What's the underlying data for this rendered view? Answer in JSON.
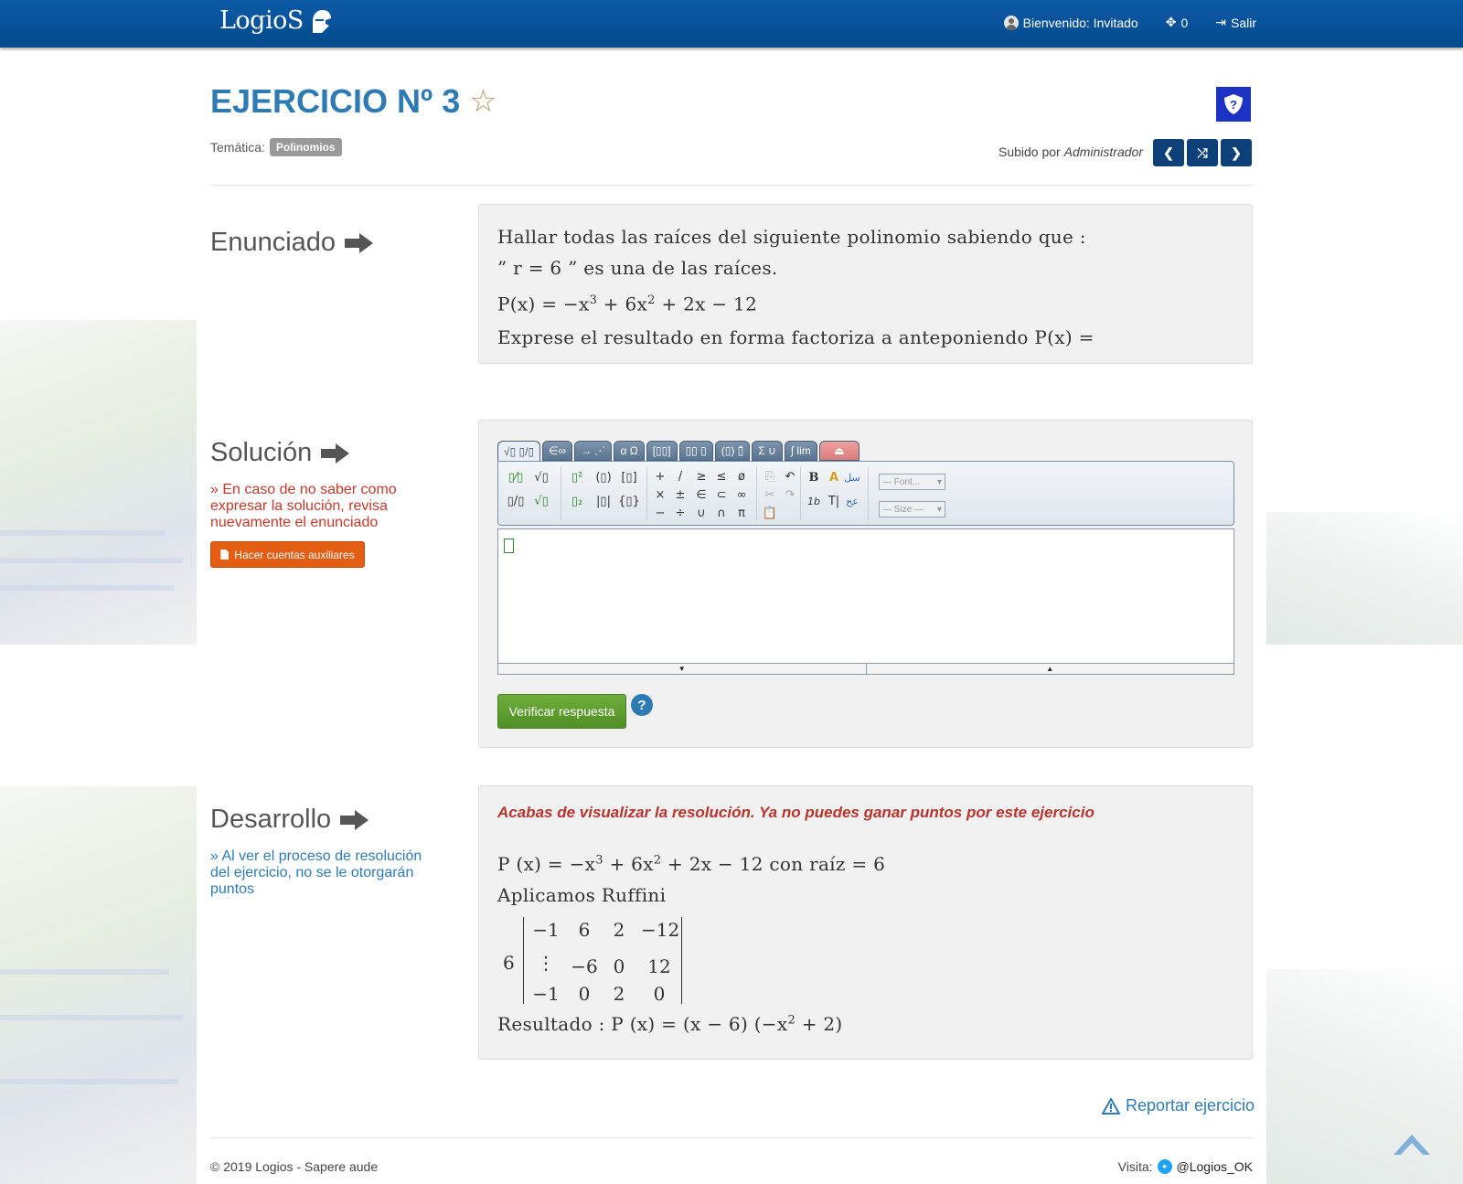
{
  "header": {
    "logo_text": "LogioS",
    "welcome": "Bienvenido: Invitado",
    "points": "0",
    "logout": "Salir"
  },
  "exercise": {
    "title": "EJERCICIO Nº 3",
    "tematica_label": "Temática:",
    "tematica_tag": "Polinomios",
    "uploaded_by_label": "Subido por",
    "uploaded_by": "Administrador"
  },
  "sections": {
    "enunciado": "Enunciado",
    "solucion": "Solución",
    "desarrollo": "Desarrollo"
  },
  "enunciado": {
    "line1": "Hallar  todas  las  raíces  del  siguiente  polinomio  sabiendo  que :",
    "line2": "” r = 6 ”  es  una  de  las  raíces.",
    "line3_pre": "P(x) = −x",
    "line3_e1": "3",
    "line3_mid": " + 6x",
    "line3_e2": "2",
    "line3_post": " + 2x − 12",
    "line4": " Exprese  el  resultado  en  forma  factoriza  a  anteponiendo  P(x) ="
  },
  "solucion": {
    "note": "» En caso de no saber como expresar la solución, revisa nuevamente el enunciado",
    "aux_button": "Hacer cuentas auxiliares",
    "verify_button": "Verificar respuesta",
    "help": "?",
    "font_select": "— Font...",
    "size_select": "— Size —"
  },
  "editor_tabs": [
    "√▯ ▯/▯",
    "∈∞",
    "→ ⋰",
    "α Ω",
    "[▯▯]",
    "▯▯ ▯",
    "(▯) ▯̂",
    "Σ ∪",
    "∫ lim",
    ""
  ],
  "desarrollo": {
    "note": "» Al ver el proceso de resolución del ejercicio, no se le otorgarán puntos",
    "warning": "Acabas de visualizar la resolución. Ya no puedes ganar puntos por este ejercicio",
    "line1_pre": "P (x) = −x",
    "line1_e1": "3",
    "line1_mid": " + 6x",
    "line1_e2": "2",
    "line1_post": " + 2x − 12  con  raíz = 6",
    "line2": " Aplicamos  Ruffini",
    "ruffini_root": "6",
    "ruffini_rows": [
      [
        "−1",
        "6",
        "2",
        "−12"
      ],
      [
        "⋮",
        "−6",
        "0",
        "12"
      ],
      [
        "−1",
        "0",
        "2",
        "0"
      ]
    ],
    "result_pre": "Resultado :  P (x) = (x − 6) (−x",
    "result_e": "2",
    "result_post": " + 2)"
  },
  "report": "Reportar ejercicio",
  "footer": {
    "copyright": "© 2019 Logios - Sapere aude",
    "visit": "Visita:",
    "twitter": "@Logios_OK"
  }
}
